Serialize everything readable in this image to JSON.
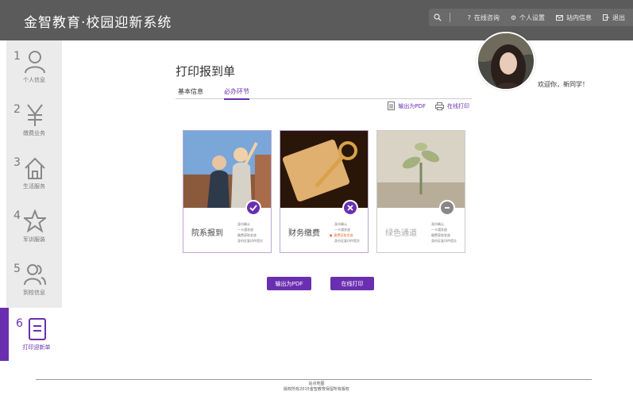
{
  "app": {
    "title": "金智教育·校园迎新系统"
  },
  "toolbar": {
    "items": [
      {
        "label": "在线咨询",
        "icon": "question-icon"
      },
      {
        "label": "个人设置",
        "icon": "gear-icon"
      },
      {
        "label": "站内信息",
        "icon": "mail-icon"
      },
      {
        "label": "退出",
        "icon": "logout-icon"
      }
    ]
  },
  "sidebar": {
    "items": [
      {
        "num": "1",
        "label": "个人信息",
        "icon": "person-icon"
      },
      {
        "num": "2",
        "label": "缴费业务",
        "icon": "yen-icon"
      },
      {
        "num": "3",
        "label": "生活服务",
        "icon": "home-icon"
      },
      {
        "num": "4",
        "label": "军训服装",
        "icon": "star-icon"
      },
      {
        "num": "5",
        "label": "到校信息",
        "icon": "group-icon"
      },
      {
        "num": "6",
        "label": "打印迎新单",
        "icon": "document-icon"
      }
    ],
    "active_index": 5
  },
  "main": {
    "title": "打印报到单",
    "tabs": [
      {
        "label": "基本信息"
      },
      {
        "label": "必办环节"
      }
    ],
    "active_tab": 1,
    "actions": {
      "pdf": "输出为PDF",
      "print": "在线打印"
    }
  },
  "user": {
    "welcome": "欢迎你，新同学！"
  },
  "cards": [
    {
      "title": "院系报到",
      "status": "done",
      "steps": [
        "身份确认",
        "一卡通发放",
        "缴费获取发放",
        "身份证复印件提交"
      ]
    },
    {
      "title": "财务缴费",
      "status": "failed",
      "steps": [
        "身份确认",
        "一卡通发放",
        "缴费获取发放",
        "身份证复印件提交"
      ]
    },
    {
      "title": "绿色通道",
      "status": "not-applicable",
      "steps": [
        "身份确认",
        "一卡通发放",
        "缴费获取发放",
        "身份证复印件提交"
      ]
    }
  ],
  "buttons": {
    "pdf": "输出为PDF",
    "print": "在线打印"
  },
  "footer": {
    "links": "站点地图",
    "copyright": "版权所有2015金智教育保留所有版权"
  },
  "colors": {
    "accent": "#6a2fb0",
    "topbar": "#5b5b5b",
    "sidebar": "#ebebeb"
  }
}
